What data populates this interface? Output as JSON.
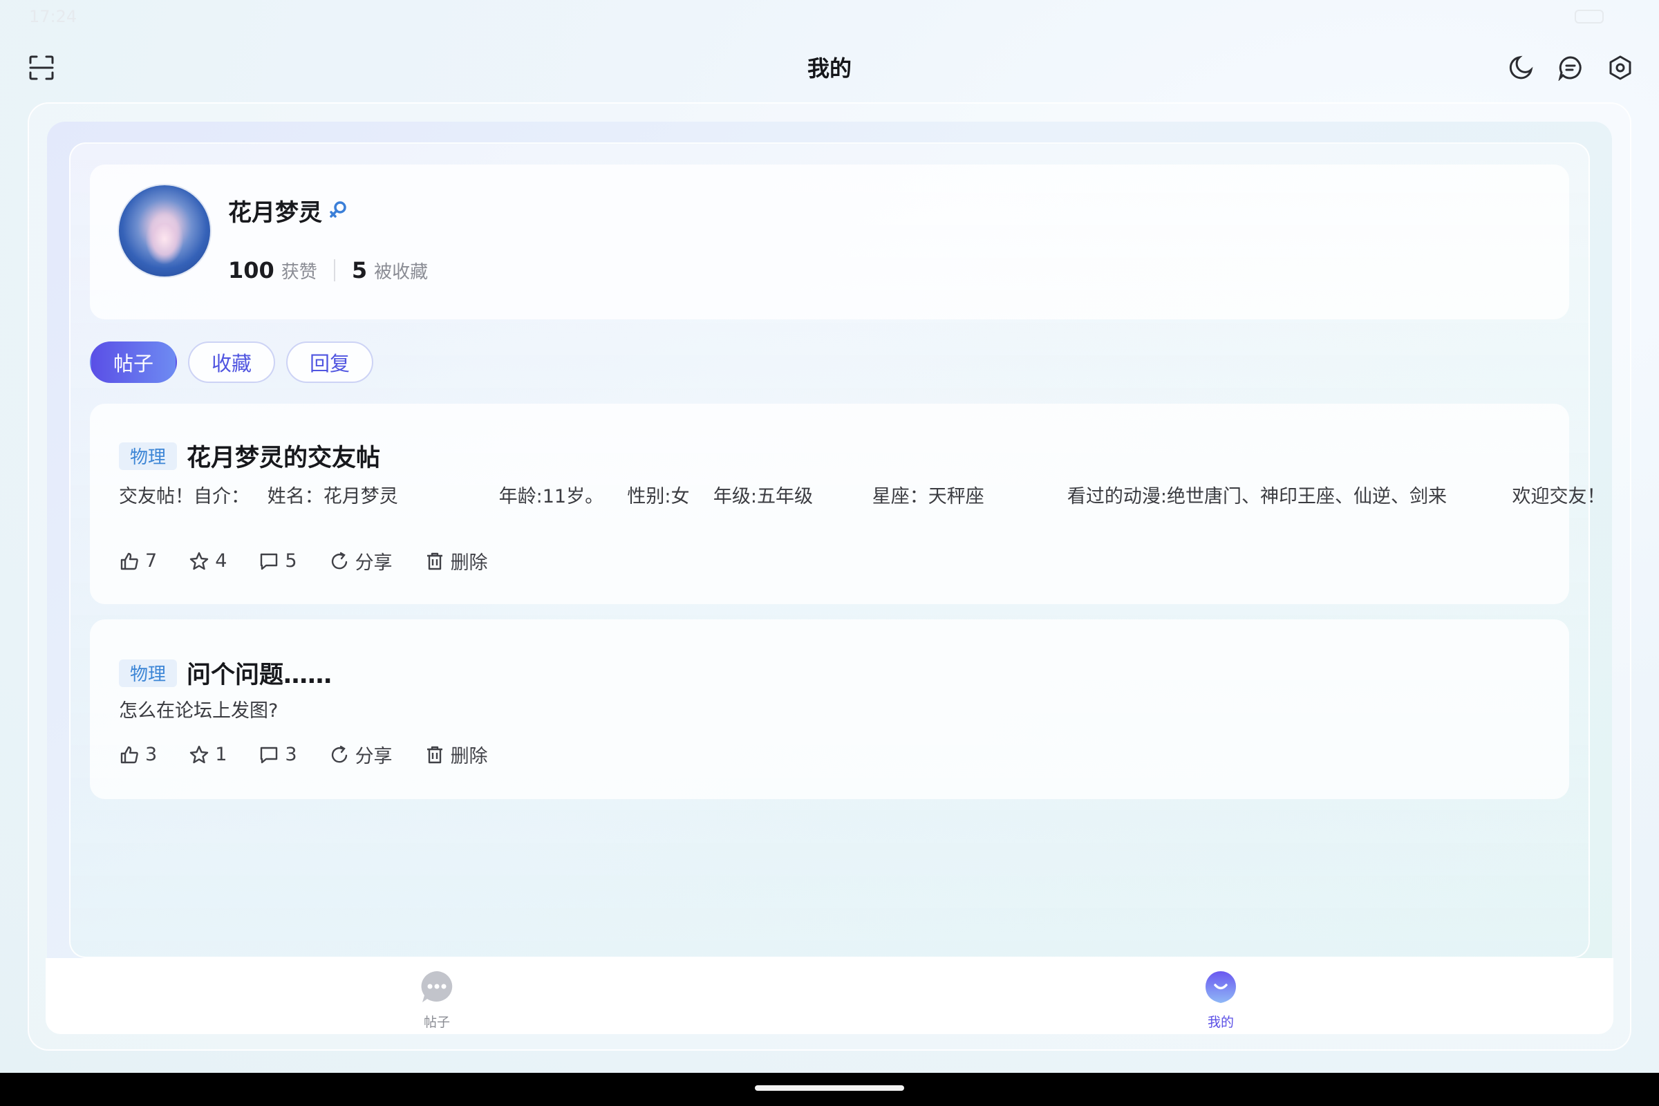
{
  "status_bar": {
    "time": "17:24"
  },
  "header": {
    "title": "我的"
  },
  "profile": {
    "name": "花月梦灵",
    "likes_count": "100",
    "likes_label": "获赞",
    "favorited_count": "5",
    "favorited_label": "被收藏"
  },
  "tabs": [
    {
      "label": "帖子",
      "active": true
    },
    {
      "label": "收藏",
      "active": false
    },
    {
      "label": "回复",
      "active": false
    }
  ],
  "posts": [
    {
      "tag": "物理",
      "title": "花月梦灵的交友帖",
      "body": "交友帖！自介：   姓名：花月梦灵                 年龄:11岁。    性别:女    年级:五年级          星座：天秤座              看过的动漫:绝世唐门、神印王座、仙逆、剑来           欢迎交友！",
      "likes": "7",
      "stars": "4",
      "comments": "5",
      "share_label": "分享",
      "delete_label": "删除"
    },
    {
      "tag": "物理",
      "title": "问个问题……",
      "body": "怎么在论坛上发图?",
      "likes": "3",
      "stars": "1",
      "comments": "3",
      "share_label": "分享",
      "delete_label": "删除"
    }
  ],
  "bottom_nav": {
    "posts_label": "帖子",
    "mine_label": "我的"
  },
  "colors": {
    "accent": "#5a4fe6",
    "tag_text": "#3d86d6",
    "tag_bg": "#e7f0fb",
    "gender": "#3b7fd8"
  },
  "icons": [
    "scan-icon",
    "moon-icon",
    "message-icon",
    "settings-icon",
    "female-icon",
    "like-icon",
    "star-icon",
    "comment-icon",
    "share-icon",
    "delete-icon",
    "chat-bubble-icon",
    "smile-icon"
  ]
}
